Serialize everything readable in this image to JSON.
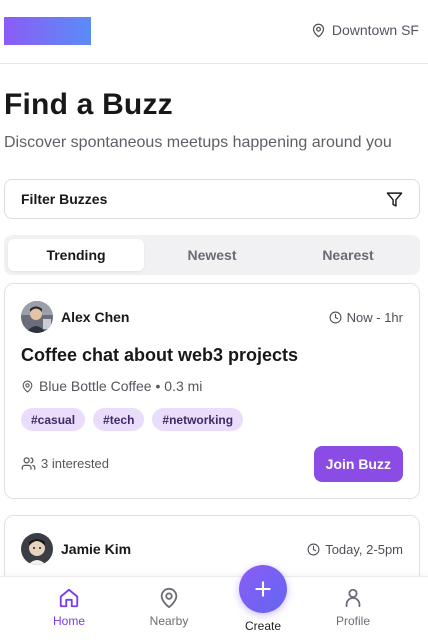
{
  "header": {
    "location": "Downtown SF",
    "logo_icon": "logo-gradient"
  },
  "main": {
    "title": "Find a Buzz",
    "subtitle": "Discover spontaneous meetups happening around you",
    "filter_label": "Filter Buzzes",
    "tabs": [
      {
        "label": "Trending",
        "active": true
      },
      {
        "label": "Newest",
        "active": false
      },
      {
        "label": "Nearest",
        "active": false
      }
    ]
  },
  "buzzes": [
    {
      "user": "Alex Chen",
      "time": "Now - 1hr",
      "title": "Coffee chat about web3 projects",
      "place": "Blue Bottle Coffee • 0.3 mi",
      "tags": [
        "#casual",
        "#tech",
        "#networking"
      ],
      "interested": "3 interested",
      "join_label": "Join Buzz"
    },
    {
      "user": "Jamie Kim",
      "time": "Today, 2-5pm"
    }
  ],
  "nav": {
    "items": [
      {
        "label": "Home",
        "icon": "home-icon",
        "active": true
      },
      {
        "label": "Nearby",
        "icon": "map-pin-icon",
        "active": false
      },
      {
        "label": "Create",
        "icon": "plus-icon",
        "active": false
      },
      {
        "label": "Profile",
        "icon": "user-icon",
        "active": false
      }
    ]
  },
  "colors": {
    "accent": "#8b4ce6",
    "tag_bg": "#e9ddfb",
    "logo_gradient_start": "#8b5cf6",
    "logo_gradient_end": "#5b8cf7"
  }
}
